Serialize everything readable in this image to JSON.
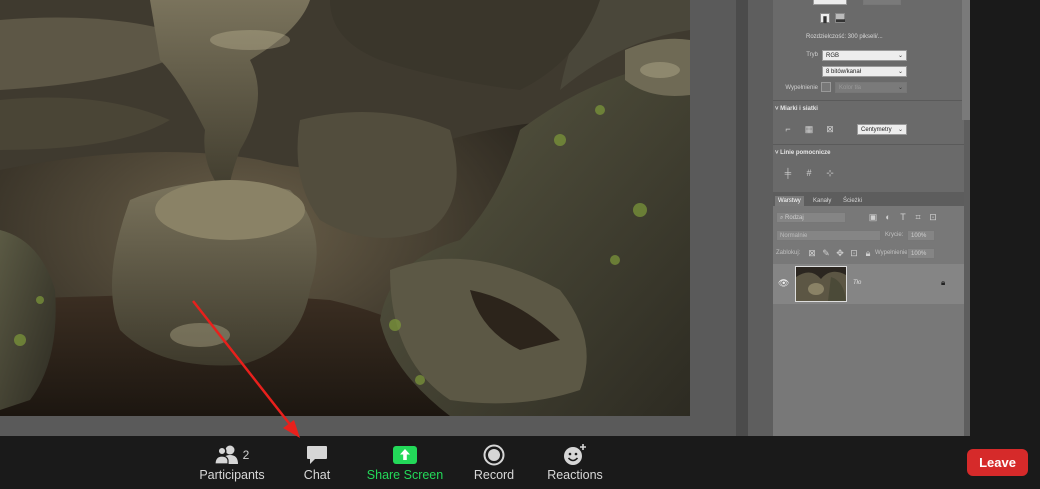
{
  "photoshop_panel": {
    "resolution_text": "Rozdzielczość: 300 pikseli/...",
    "mode_label": "Tryb",
    "mode_value": "RGB",
    "bits_value": "8 bitów/kanał",
    "fill_label": "Wypełnienie",
    "fill_value": "Kolor tła",
    "rulers_section": "Miarki i siatki",
    "units_value": "Centymetry",
    "guides_section": "Linie pomocnicze",
    "layer_tabs": [
      "Warstwy",
      "Kanały",
      "Ścieżki"
    ],
    "kind_filter": "Rodzaj",
    "blend_mode": "Normalnie",
    "opacity_label": "Krycie:",
    "opacity_value": "100%",
    "lock_label": "Zablokuj:",
    "fill2_label": "Wypełnienie:",
    "fill2_value": "100%",
    "layer_name": "Tło"
  },
  "toolbar": {
    "participants_label": "Participants",
    "participants_count": "2",
    "chat_label": "Chat",
    "share_label": "Share Screen",
    "record_label": "Record",
    "reactions_label": "Reactions",
    "leave_label": "Leave"
  },
  "colors": {
    "leave_button": "#d62a2a",
    "share_accent": "#23d959",
    "annotation_arrow": "#e8201c"
  },
  "icons": [
    "participants-icon",
    "chat-icon",
    "share-screen-icon",
    "record-icon",
    "reactions-icon",
    "eye-icon",
    "lock-icon"
  ]
}
